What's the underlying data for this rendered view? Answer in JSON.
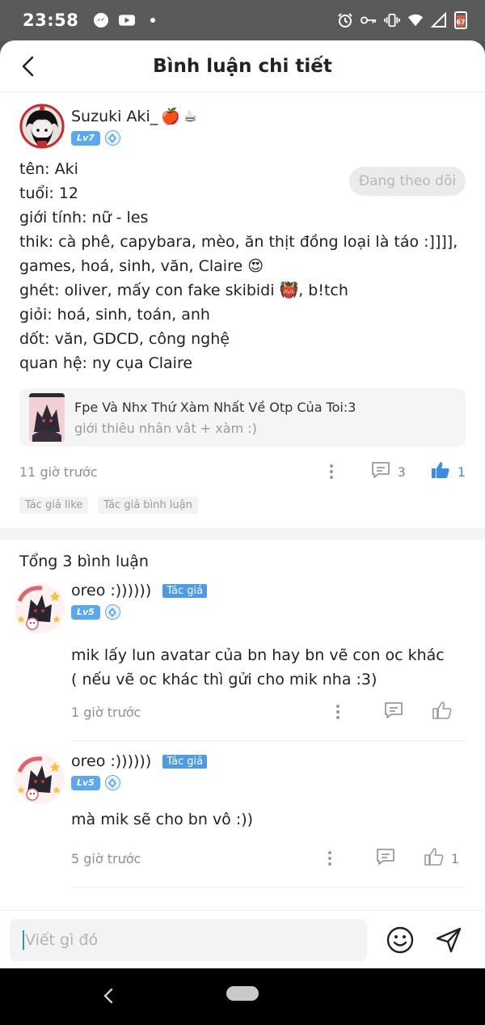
{
  "status_bar": {
    "time": "23:58",
    "battery": "67"
  },
  "header": {
    "title": "Bình luận chi tiết"
  },
  "post": {
    "author_name": "Suzuki Aki_",
    "name_emojis": [
      "🍎",
      "☕"
    ],
    "level": "Lv7",
    "follow_label": "Đang theo dõi",
    "body_lines": [
      "tên: Aki",
      "tuổi: 12",
      "giới tính: nữ - les",
      "thik: cà phê, capybara, mèo, ăn thịt đồng loại là táo :]]]],",
      "games, hoá, sinh, văn, Claire 😍",
      "ghét: oliver, mấy con fake skibidi 👹, b!tch",
      "giỏi: hoá, sinh, toán, anh",
      "dốt: văn, GDCD, công nghệ",
      "quan hệ: ny cụa Claire"
    ],
    "topic": {
      "title": "Fpe Và Nhx Thứ Xàm Nhất Về Otp Của Toi:3",
      "subtitle": "giới thiêu nhân vât + xàm :)"
    },
    "time": "11 giờ trước",
    "comment_count": "3",
    "like_count": "1",
    "tags": [
      "Tác giả like",
      "Tác giả bình luận"
    ]
  },
  "comments_section": {
    "title": "Tổng 3 bình luận",
    "items": [
      {
        "name": "oreo :))))))",
        "author_tag": "Tác giả",
        "level": "Lv5",
        "lines": [
          "mik lấy lun avatar của bn hay bn vẽ con oc khác",
          "( nếu vẽ oc khác thì gửi cho mik nha :3)"
        ],
        "time": "1 giờ trước",
        "like_count": ""
      },
      {
        "name": "oreo :))))))",
        "author_tag": "Tác giả",
        "level": "Lv5",
        "lines": [
          "mà mik sẽ cho bn vô :))"
        ],
        "time": "5 giờ trước",
        "like_count": "1"
      }
    ]
  },
  "input_bar": {
    "placeholder": "Viết gì đó"
  },
  "colors": {
    "accent_blue": "#3c8ce6",
    "level_badge": "#5aa8ee",
    "author_tag": "#4d9be6"
  },
  "icons": {
    "status_left": [
      "messenger-icon",
      "youtube-icon",
      "dot-icon"
    ],
    "status_right": [
      "alarm-icon",
      "key-icon",
      "vibrate-icon",
      "wifi-icon",
      "signal-icon",
      "battery-icon"
    ]
  }
}
